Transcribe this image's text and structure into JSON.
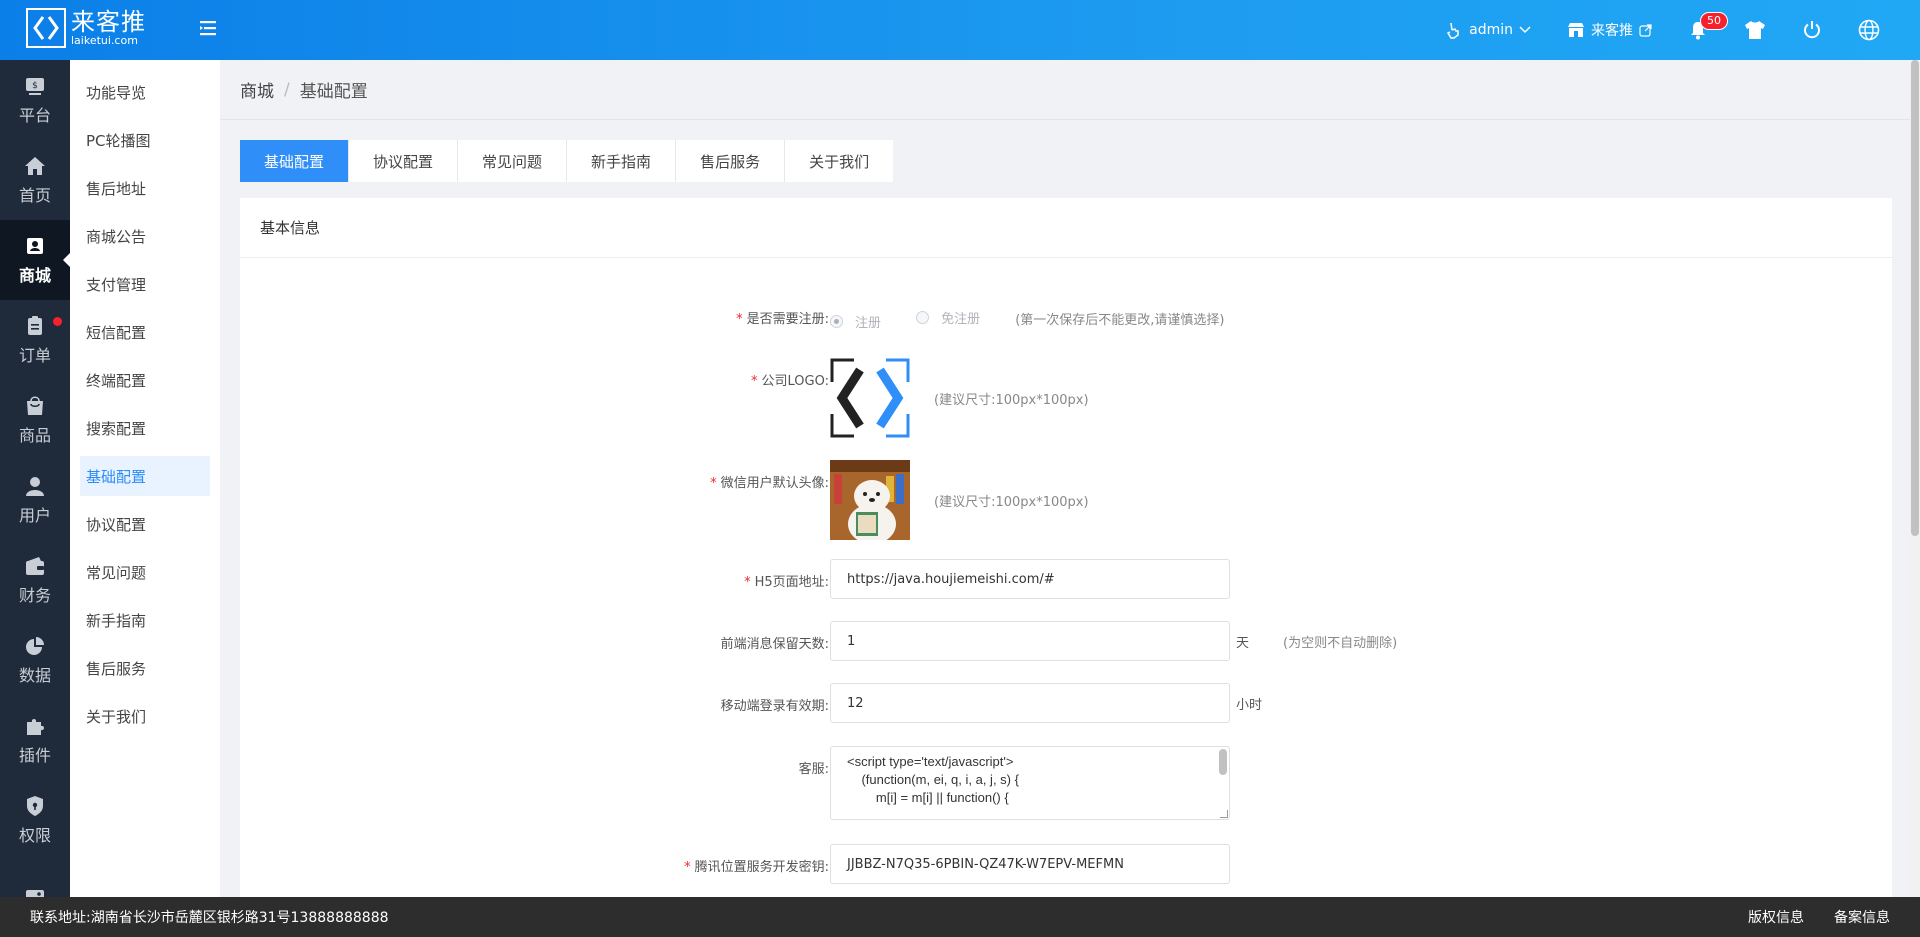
{
  "header": {
    "logo_cn": "来客推",
    "logo_en": "laiketui.com",
    "user": "admin",
    "store": "来客推",
    "notify_count": "50"
  },
  "rail": [
    {
      "label": "平台",
      "icon": "platform-icon"
    },
    {
      "label": "首页",
      "icon": "home-icon"
    },
    {
      "label": "商城",
      "icon": "store-icon",
      "active": true
    },
    {
      "label": "订单",
      "icon": "order-icon",
      "dot": true
    },
    {
      "label": "商品",
      "icon": "goods-icon"
    },
    {
      "label": "用户",
      "icon": "user-icon"
    },
    {
      "label": "财务",
      "icon": "wallet-icon"
    },
    {
      "label": "数据",
      "icon": "pie-chart-icon"
    },
    {
      "label": "插件",
      "icon": "puzzle-icon"
    },
    {
      "label": "权限",
      "icon": "shield-icon"
    },
    {
      "label": "",
      "icon": "image-icon"
    }
  ],
  "submenu": [
    {
      "label": "功能导览"
    },
    {
      "label": "PC轮播图"
    },
    {
      "label": "售后地址"
    },
    {
      "label": "商城公告"
    },
    {
      "label": "支付管理"
    },
    {
      "label": "短信配置"
    },
    {
      "label": "终端配置"
    },
    {
      "label": "搜索配置"
    },
    {
      "label": "基础配置",
      "active": true
    },
    {
      "label": "协议配置"
    },
    {
      "label": "常见问题"
    },
    {
      "label": "新手指南"
    },
    {
      "label": "售后服务"
    },
    {
      "label": "关于我们"
    }
  ],
  "breadcrumb": {
    "root": "商城",
    "sep": "/",
    "current": "基础配置"
  },
  "tabs": [
    {
      "label": "基础配置",
      "active": true
    },
    {
      "label": "协议配置"
    },
    {
      "label": "常见问题"
    },
    {
      "label": "新手指南"
    },
    {
      "label": "售后服务"
    },
    {
      "label": "关于我们"
    }
  ],
  "card": {
    "title": "基本信息"
  },
  "form": {
    "register": {
      "label": "是否需要注册:",
      "opt1": "注册",
      "opt2": "免注册",
      "hint": "(第一次保存后不能更改,请谨慎选择)"
    },
    "logo": {
      "label": "公司LOGO:",
      "hint": "(建议尺寸:100px*100px)"
    },
    "avatar": {
      "label": "微信用户默认头像:",
      "hint": "(建议尺寸:100px*100px)"
    },
    "h5": {
      "label": "H5页面地址:",
      "value": "https://java.houjiemeishi.com/#"
    },
    "msg_days": {
      "label": "前端消息保留天数:",
      "value": "1",
      "unit": "天",
      "hint": "(为空则不自动删除)"
    },
    "login_valid": {
      "label": "移动端登录有效期:",
      "value": "12",
      "unit": "小时"
    },
    "service": {
      "label": "客服:",
      "value": "<script type='text/javascript'>\n    (function(m, ei, q, i, a, j, s) {\n        m[i] = m[i] || function() {"
    },
    "tencent_key": {
      "label": "腾讯位置服务开发密钥:",
      "value": "JJBBZ-N7Q35-6PBIN-QZ47K-W7EPV-MEFMN"
    }
  },
  "footer": {
    "address": "联系地址:湖南省长沙市岳麓区银杉路31号13888888888",
    "copyright": "版权信息",
    "icp": "备案信息"
  }
}
